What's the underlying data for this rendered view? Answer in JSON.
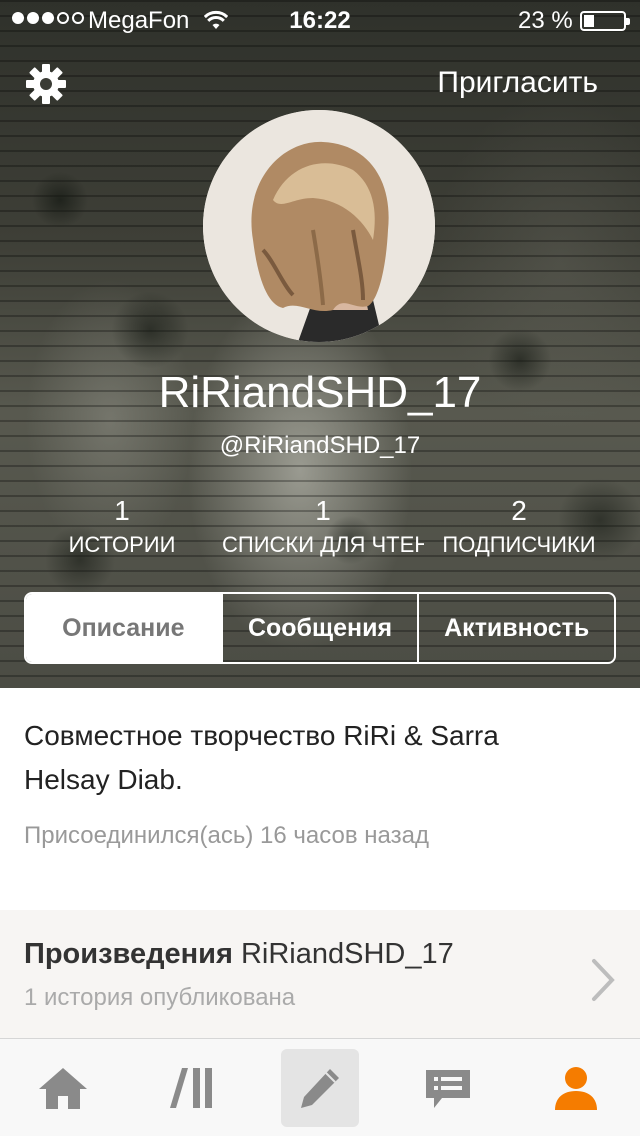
{
  "status_bar": {
    "carrier": "MegaFon",
    "time": "16:22",
    "battery_text": "23 %",
    "battery_level": 0.23,
    "signal_full": 3,
    "signal_total": 5
  },
  "header": {
    "invite_label": "Пригласить",
    "settings_icon": "gear-icon"
  },
  "profile": {
    "display_name": "RiRiandSHD_17",
    "handle": "@RiRiandSHD_17"
  },
  "stats": [
    {
      "count": "1",
      "label": "ИСТОРИИ"
    },
    {
      "count": "1",
      "label": "СПИСКИ ДЛЯ ЧТЕНИЯ"
    },
    {
      "count": "2",
      "label": "ПОДПИСЧИКИ"
    }
  ],
  "tabs": [
    {
      "label": "Описание",
      "active": true
    },
    {
      "label": "Сообщения",
      "active": false
    },
    {
      "label": "Активность",
      "active": false
    }
  ],
  "about": {
    "description": "Совместное творчество RiRi & Sarra Helsay Diab.",
    "joined": "Присоединился(ась) 16 часов назад"
  },
  "works": {
    "title_bold": "Произведения",
    "title_name": "RiRiandSHD_17",
    "subtitle": "1 история опубликована"
  },
  "tab_bar": {
    "items": [
      "home-icon",
      "library-icon",
      "write-icon",
      "messages-icon",
      "profile-icon"
    ],
    "active_item": "profile-icon",
    "accent_color": "#f57c00",
    "inactive_color": "#8a8a8a"
  }
}
